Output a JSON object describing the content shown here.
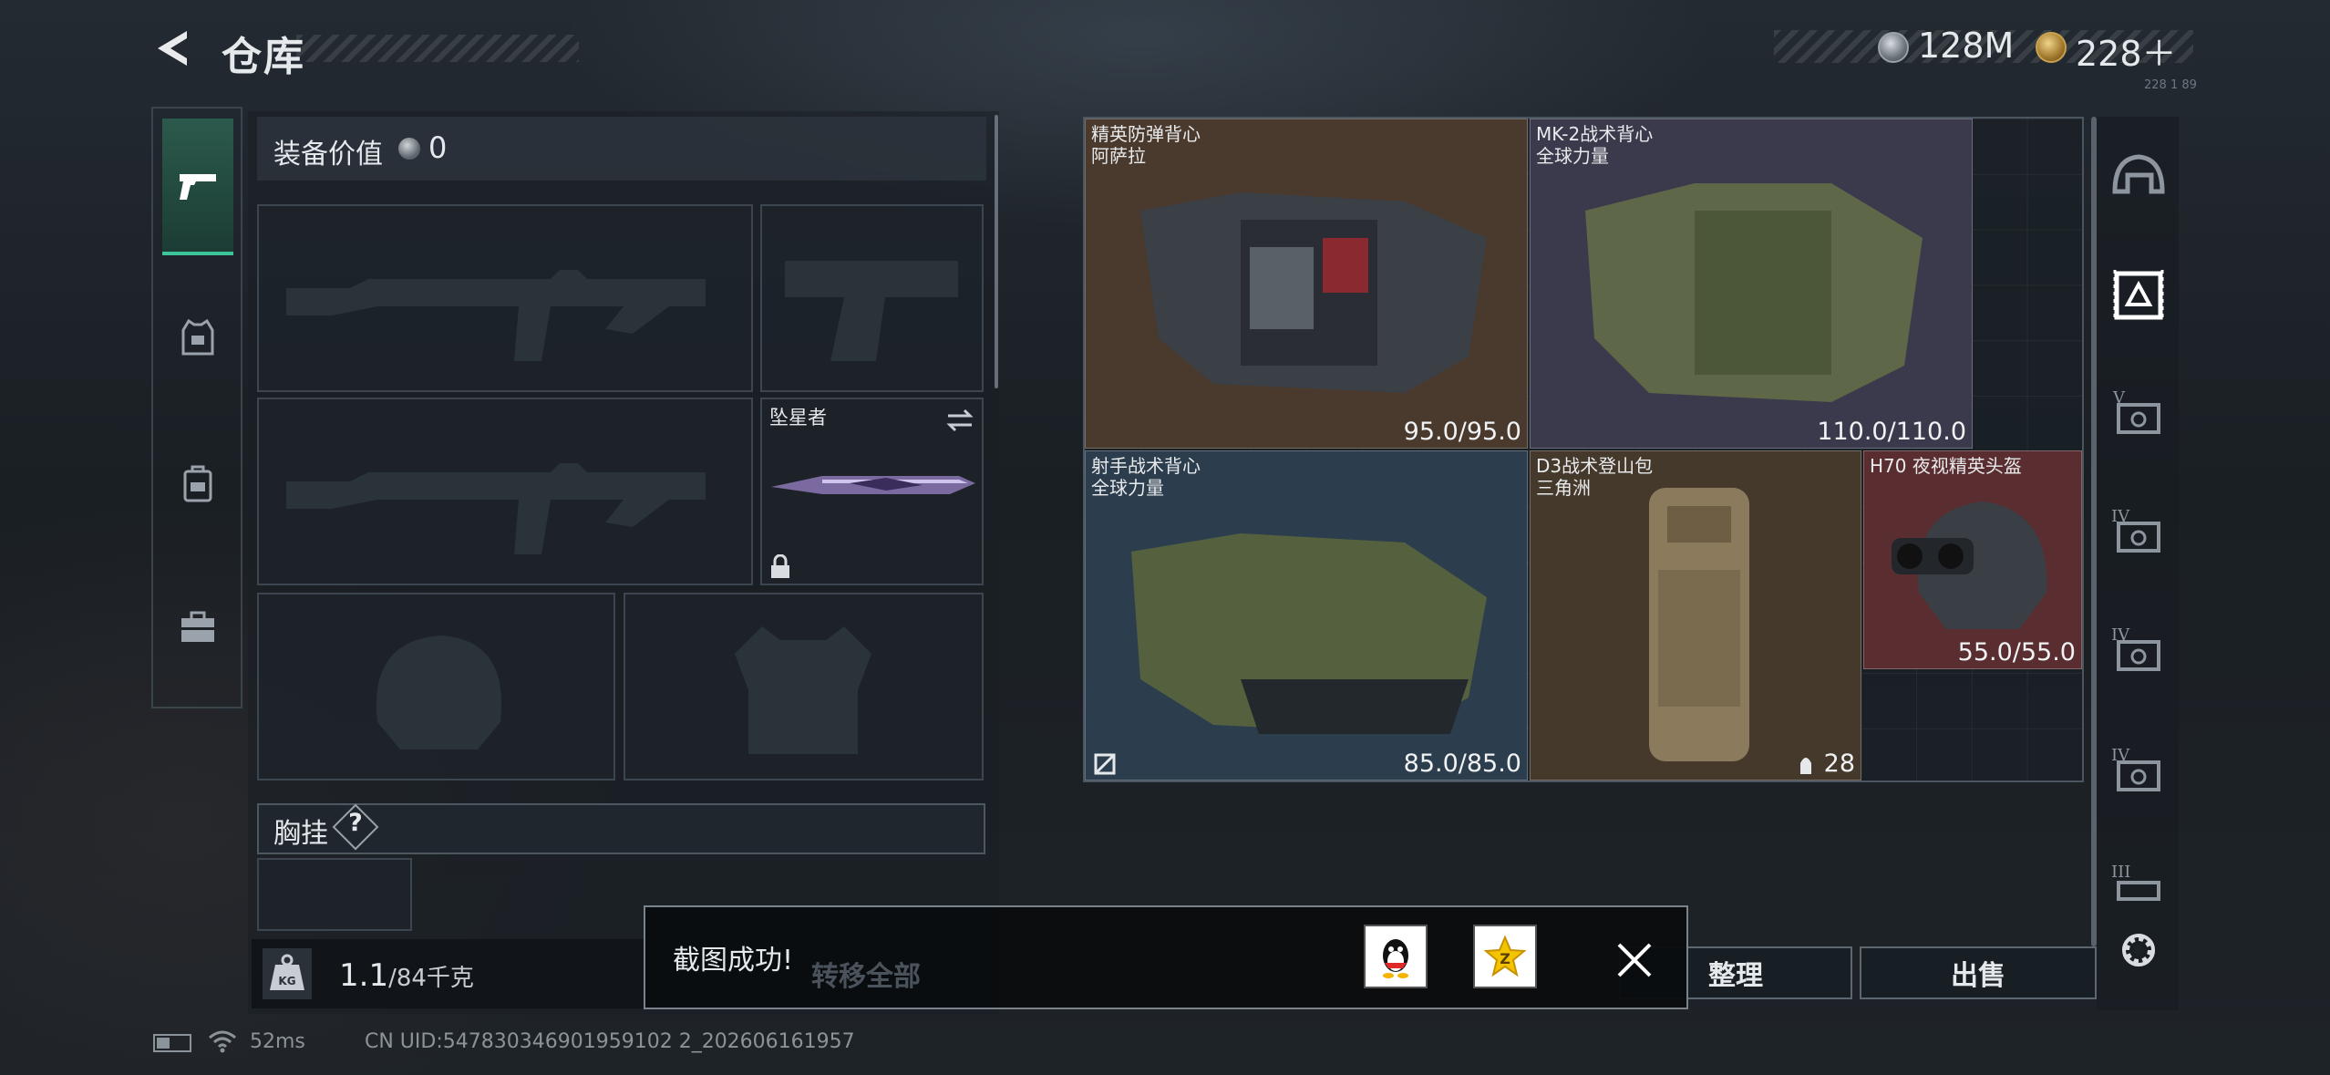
{
  "header": {
    "title": "仓库",
    "currency_silver": "128M",
    "currency_gold": "228＋",
    "currency_tiny": "228 1 89"
  },
  "left_tabs": [
    {
      "name": "weapons",
      "icon": "pistol-icon",
      "active": true
    },
    {
      "name": "armor",
      "icon": "armor-vest-icon"
    },
    {
      "name": "backpack",
      "icon": "backpack-icon"
    },
    {
      "name": "case",
      "icon": "briefcase-icon"
    }
  ],
  "equipment": {
    "value_label": "装备价值",
    "value": "0",
    "melee_name": "坠星者",
    "chest_label": "胸挂",
    "chest_help": "?",
    "weight_value": "1.1",
    "weight_max": "/84千克"
  },
  "storage_items": [
    {
      "name": "精英防弹背心",
      "sub": "阿萨拉",
      "durability": "95.0/95.0",
      "color": "#4a3a2e"
    },
    {
      "name": "MK-2战术背心",
      "sub": "全球力量",
      "durability": "110.0/110.0",
      "color": "#3a3a4c"
    },
    {
      "name": "射手战术背心",
      "sub": "全球力量",
      "durability": "85.0/85.0",
      "color": "#2c3d4d"
    },
    {
      "name": "D3战术登山包",
      "sub": "三角洲",
      "count": "28",
      "color": "#45392c"
    },
    {
      "name": "H70 夜视精英头盔",
      "sub": "",
      "durability": "55.0/55.0",
      "color": "#5a2e30"
    }
  ],
  "right_categories": [
    "helmet-category",
    "armor-category",
    "tier-v-category",
    "tier-iv-category-1",
    "tier-iv-category-2",
    "tier-iv-category-3",
    "tier-iii-category"
  ],
  "buttons": {
    "tidy": "整理",
    "sell": "出售",
    "transfer_all": "转移全部"
  },
  "toast": {
    "message": "截图成功!"
  },
  "status": {
    "ping": "52ms",
    "uid": "CN UID:547830346901959102 2_202606161957"
  }
}
